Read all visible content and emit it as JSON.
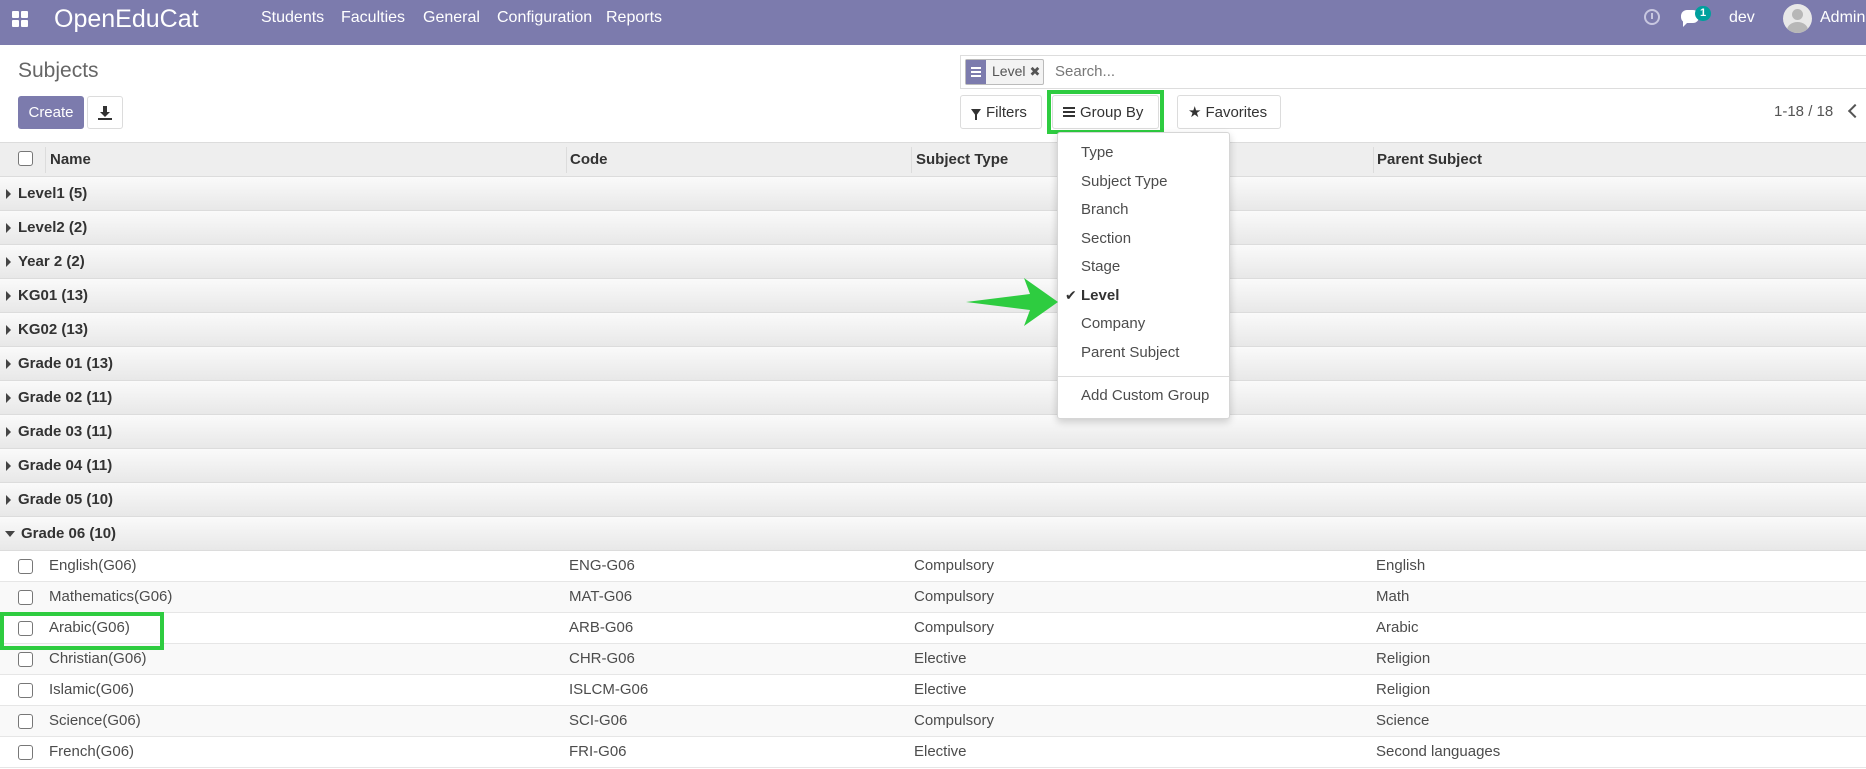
{
  "navbar": {
    "brand": "OpenEduCat",
    "menu": [
      "Students",
      "Faculties",
      "General",
      "Configuration",
      "Reports"
    ],
    "chat_count": "1",
    "db_name": "dev",
    "user_name": "Adminis"
  },
  "control_panel": {
    "title": "Subjects",
    "create_label": "Create",
    "search": {
      "facet_label": "Level",
      "facet_remove": "✖",
      "placeholder": "Search..."
    },
    "filters_label": "Filters",
    "groupby_label": "Group By",
    "favorites_label": "Favorites",
    "pager": "1-18 / 18"
  },
  "table": {
    "headers": [
      "Name",
      "Code",
      "Subject Type",
      "Parent Subject"
    ],
    "groups": [
      {
        "label": "Level1 (5)"
      },
      {
        "label": "Level2 (2)"
      },
      {
        "label": "Year 2 (2)"
      },
      {
        "label": "KG01 (13)"
      },
      {
        "label": "KG02 (13)"
      },
      {
        "label": "Grade 01 (13)"
      },
      {
        "label": "Grade 02 (11)"
      },
      {
        "label": "Grade 03 (11)"
      },
      {
        "label": "Grade 04 (11)"
      },
      {
        "label": "Grade 05 (10)"
      },
      {
        "label": "Grade 06 (10)"
      }
    ],
    "rows": [
      {
        "name": "English(G06)",
        "code": "ENG-G06",
        "type": "Compulsory",
        "parent": "English"
      },
      {
        "name": "Mathematics(G06)",
        "code": "MAT-G06",
        "type": "Compulsory",
        "parent": "Math"
      },
      {
        "name": "Arabic(G06)",
        "code": "ARB-G06",
        "type": "Compulsory",
        "parent": "Arabic"
      },
      {
        "name": "Christian(G06)",
        "code": "CHR-G06",
        "type": "Elective",
        "parent": "Religion"
      },
      {
        "name": "Islamic(G06)",
        "code": "ISLCM-G06",
        "type": "Elective",
        "parent": "Religion"
      },
      {
        "name": "Science(G06)",
        "code": "SCI-G06",
        "type": "Compulsory",
        "parent": "Science"
      },
      {
        "name": "French(G06)",
        "code": "FRI-G06",
        "type": "Elective",
        "parent": "Second languages"
      }
    ]
  },
  "groupby_menu": {
    "items": [
      "Type",
      "Subject Type",
      "Branch",
      "Section",
      "Stage",
      "Level",
      "Company",
      "Parent Subject"
    ],
    "selected": "Level",
    "custom_label": "Add Custom Group"
  },
  "colors": {
    "brand": "#7c7bad",
    "highlight": "#2ecc40",
    "badge": "#00a09d"
  }
}
